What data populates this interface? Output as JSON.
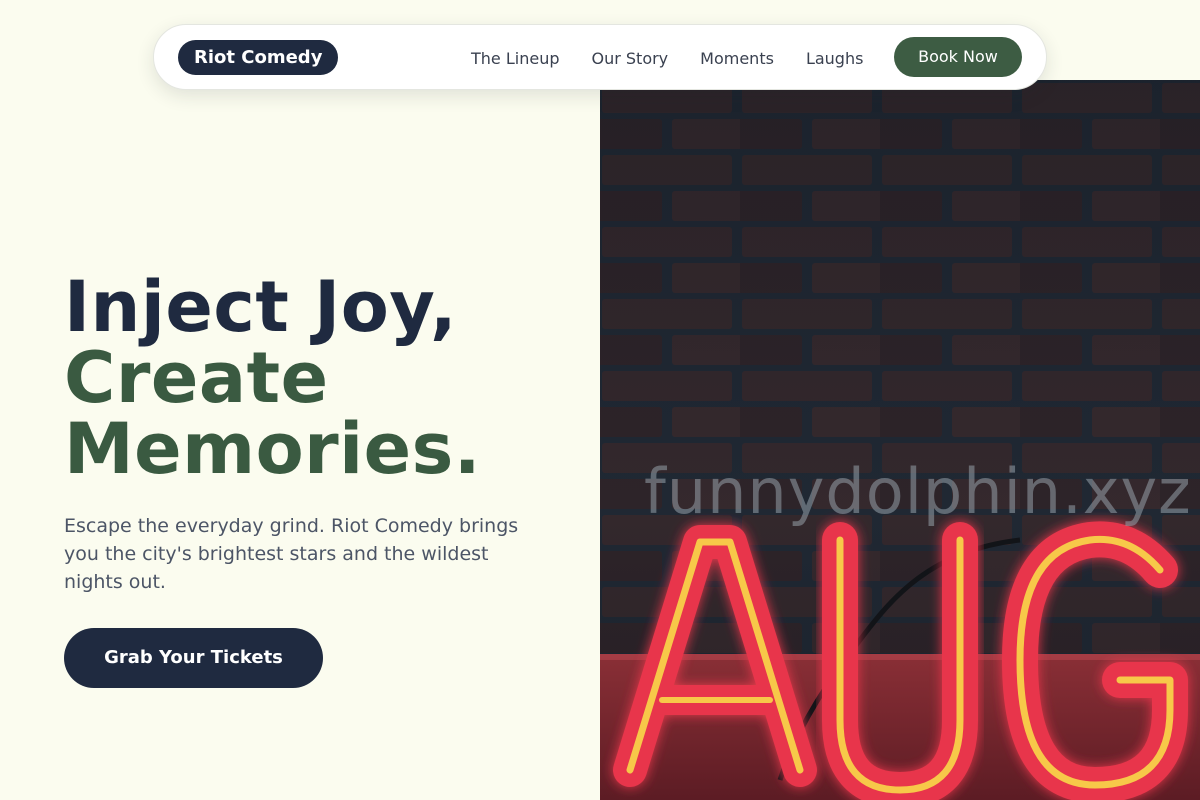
{
  "nav": {
    "brand": "Riot Comedy",
    "links": [
      {
        "label": "The Lineup"
      },
      {
        "label": "Our Story"
      },
      {
        "label": "Moments"
      },
      {
        "label": "Laughs"
      }
    ],
    "book_label": "Book Now"
  },
  "hero": {
    "headline_line1": "Inject Joy,",
    "headline_line2": "Create",
    "headline_line3": "Memories.",
    "description": "Escape the everyday grind. Riot Comedy brings you the city's brightest stars and the wildest nights out.",
    "cta_label": "Grab Your Tickets",
    "image": {
      "sign_text": "AUG",
      "watermark": "funnydolphin.xyz"
    }
  },
  "colors": {
    "background": "#fbfcef",
    "navy": "#1f2a40",
    "green": "#3d5c43",
    "neon_red": "#e8354b",
    "neon_yellow": "#f7c84a"
  }
}
